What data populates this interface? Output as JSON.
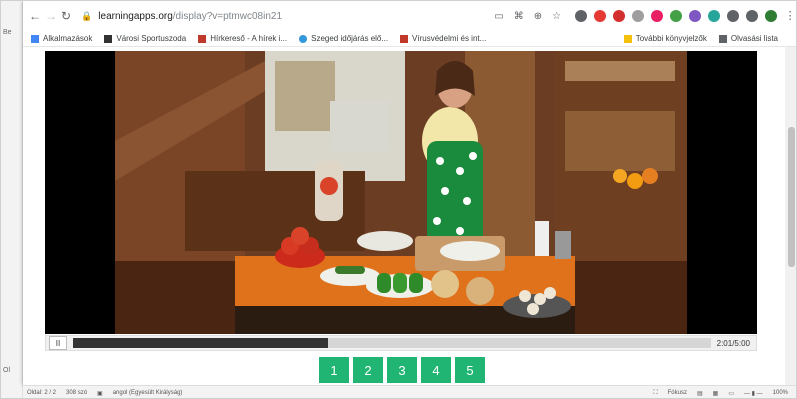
{
  "background_window": {
    "left_label_top": "Be",
    "left_label_bottom": "Ol"
  },
  "browser": {
    "url_host": "learningapps.org",
    "url_path": "/display?v=ptmwc08in21",
    "bookmarks": [
      {
        "label": "Alkalmazások",
        "color": "#4285f4"
      },
      {
        "label": "Városi Sportuszoda",
        "color": "#333333"
      },
      {
        "label": "Hírkereső - A hírek i...",
        "color": "#c0392b"
      },
      {
        "label": "Szeged időjárás elő...",
        "color": "#3498db"
      },
      {
        "label": "Vírusvédelmi és int...",
        "color": "#c0392b"
      }
    ],
    "bookmarks_right": [
      {
        "label": "További könyvjelzők",
        "color": "#f4c20d"
      },
      {
        "label": "Olvasási lista",
        "color": "#5f6368"
      }
    ]
  },
  "video": {
    "time": "2:01/5:00",
    "progress": 0.4,
    "play_glyph": "II"
  },
  "pager": [
    "1",
    "2",
    "3",
    "4",
    "5"
  ],
  "statusbar": {
    "page": "Oldal: 2 / 2",
    "words": "308 szó",
    "language": "angol (Egyesült Királyság)",
    "focus": "Fókusz",
    "zoom": "100%"
  }
}
